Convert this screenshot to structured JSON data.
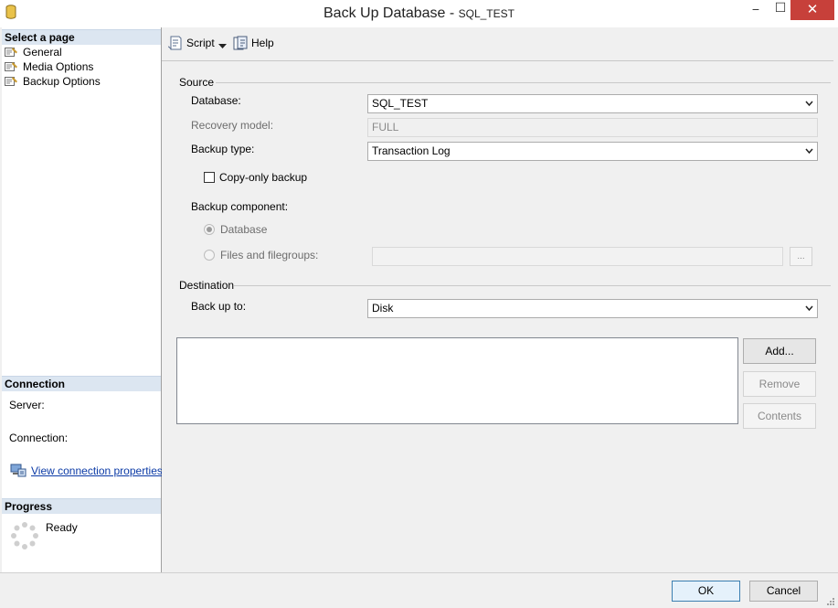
{
  "window": {
    "title_prefix": "Back Up Database - ",
    "title_db": "SQL_TEST",
    "minimize": "−",
    "maximize": "☐",
    "close": "✕"
  },
  "left": {
    "select_page_header": "Select a page",
    "pages": [
      {
        "label": "General"
      },
      {
        "label": "Media Options"
      },
      {
        "label": "Backup Options"
      }
    ],
    "connection_header": "Connection",
    "server_label": "Server:",
    "connection_label": "Connection:",
    "view_connection_link": "View connection properties",
    "progress_header": "Progress",
    "progress_status": "Ready"
  },
  "toolbar": {
    "script_label": "Script",
    "help_label": "Help"
  },
  "source": {
    "group_label": "Source",
    "database_label": "Database:",
    "database_value": "SQL_TEST",
    "recovery_label": "Recovery model:",
    "recovery_value": "FULL",
    "backup_type_label": "Backup type:",
    "backup_type_value": "Transaction Log",
    "copy_only_label": "Copy-only backup",
    "component_label": "Backup component:",
    "radio_database": "Database",
    "radio_files": "Files and filegroups:",
    "browse_label": "..."
  },
  "destination": {
    "group_label": "Destination",
    "backup_to_label": "Back up to:",
    "backup_to_value": "Disk",
    "add_button": "Add...",
    "remove_button": "Remove",
    "contents_button": "Contents"
  },
  "footer": {
    "ok_button": "OK",
    "cancel_button": "Cancel"
  }
}
